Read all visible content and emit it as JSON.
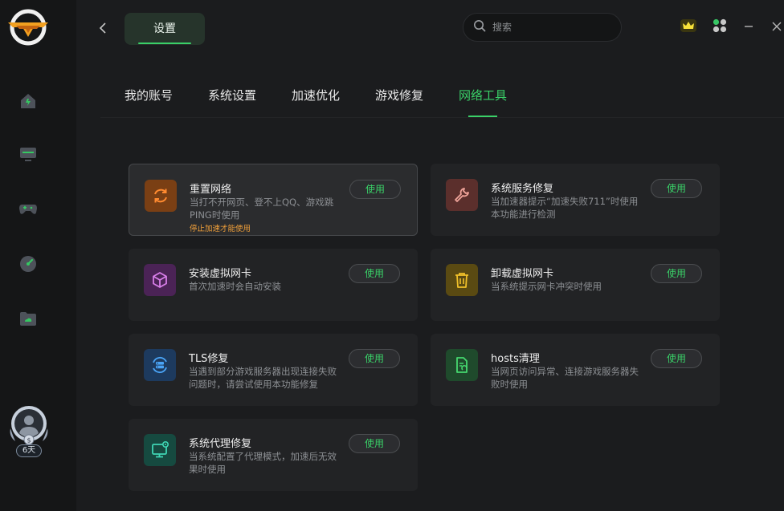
{
  "header": {
    "page_title": "设置",
    "search_placeholder": "搜索"
  },
  "sidebar": {
    "nav": [
      "home-icon",
      "monitor-icon",
      "gamepad-icon",
      "speedometer-icon",
      "folder-icon"
    ],
    "avatar_days": "6天"
  },
  "tabs": [
    {
      "label": "我的账号",
      "active": false
    },
    {
      "label": "系统设置",
      "active": false
    },
    {
      "label": "加速优化",
      "active": false
    },
    {
      "label": "游戏修复",
      "active": false
    },
    {
      "label": "网络工具",
      "active": true
    }
  ],
  "cards": [
    {
      "title": "重置网络",
      "desc": "当打不开网页、登不上QQ、游戏跳PING时使用",
      "warn": "停止加速才能使用",
      "button": "使用",
      "icon": "refresh-icon",
      "icon_bg": "#7a3f14",
      "icon_color": "#ff8a30"
    },
    {
      "title": "系统服务修复",
      "desc": "当加速器提示“加速失败711”时使用本功能进行检测",
      "button": "使用",
      "icon": "wrench-icon",
      "icon_bg": "#5b2f2c",
      "icon_color": "#f0a49a"
    },
    {
      "title": "安装虚拟网卡",
      "desc": "首次加速时会自动安装",
      "button": "使用",
      "icon": "cube-icon",
      "icon_bg": "#4b2356",
      "icon_color": "#d77ee8"
    },
    {
      "title": "卸载虚拟网卡",
      "desc": "当系统提示网卡冲突时使用",
      "button": "使用",
      "icon": "trash-icon",
      "icon_bg": "#5a4a12",
      "icon_color": "#f1c12a"
    },
    {
      "title": "TLS修复",
      "desc": "当遇到部分游戏服务器出现连接失败问题时，请尝试使用本功能修复",
      "button": "使用",
      "icon": "server-repair-icon",
      "icon_bg": "#1d3a5e",
      "icon_color": "#4aa3f5"
    },
    {
      "title": "hosts清理",
      "desc": "当网页访问异常、连接游戏服务器失败时使用",
      "button": "使用",
      "icon": "file-clean-icon",
      "icon_bg": "#1f4a2c",
      "icon_color": "#46d86f"
    },
    {
      "title": "系统代理修复",
      "desc": "当系统配置了代理模式，加速后无效果时使用",
      "button": "使用",
      "icon": "monitor-settings-icon",
      "icon_bg": "#164a40",
      "icon_color": "#3fd6b4"
    }
  ]
}
